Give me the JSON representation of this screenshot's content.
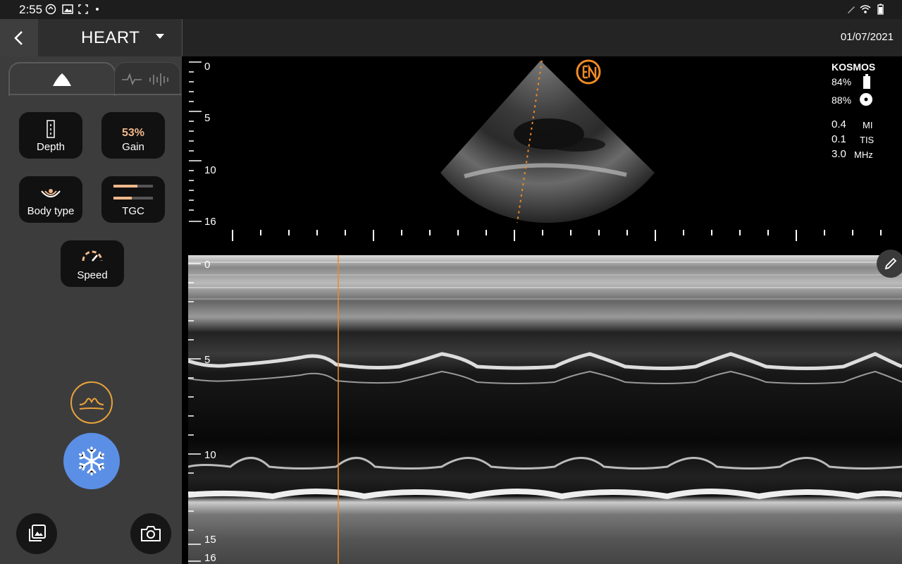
{
  "status_bar": {
    "time": "2:55"
  },
  "header": {
    "preset": "HEART",
    "date": "01/07/2021"
  },
  "controls": {
    "depth_label": "Depth",
    "gain_value": "53%",
    "gain_label": "Gain",
    "body_type_label": "Body type",
    "tgc_label": "TGC",
    "speed_label": "Speed"
  },
  "bmode_depth_labels": [
    "0",
    "5",
    "10",
    "16"
  ],
  "mmode_depth_labels": [
    "0",
    "5",
    "10",
    "15",
    "16"
  ],
  "info_panel": {
    "device": "KOSMOS",
    "battery": "84%",
    "probe": "88%",
    "mi_value": "0.4",
    "mi_label": "MI",
    "tis_value": "0.1",
    "tis_label": "TIS",
    "freq_value": "3.0",
    "freq_label": "MHz"
  },
  "colors": {
    "accent_orange": "#e8a23a",
    "gain_text": "#f0b88a",
    "freeze_blue": "#5b8fe6",
    "logo_orange": "#f08a24"
  }
}
